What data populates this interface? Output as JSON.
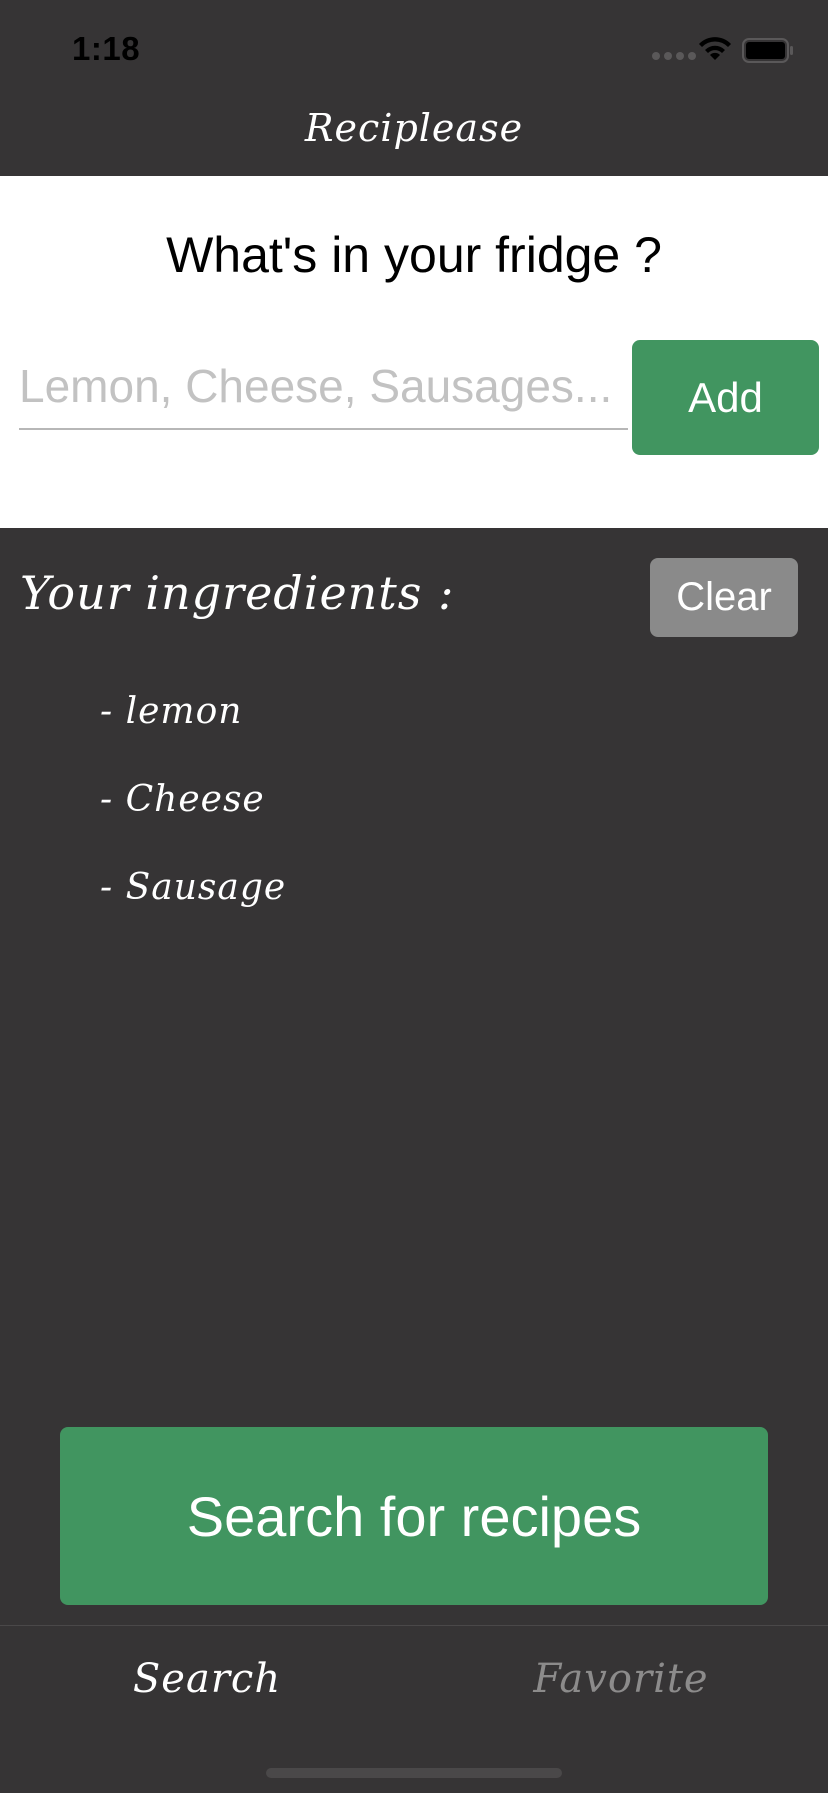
{
  "status_bar": {
    "time": "1:18",
    "icons": [
      "signal-icon",
      "wifi-icon",
      "battery-icon"
    ]
  },
  "nav": {
    "title": "Reciplease"
  },
  "fridge": {
    "question": "What's in your fridge ?",
    "input_placeholder": "Lemon, Cheese, Sausages...",
    "input_value": "",
    "add_label": "Add"
  },
  "ingredients": {
    "header": "Your ingredients :",
    "clear_label": "Clear",
    "items": [
      {
        "label": "- lemon"
      },
      {
        "label": "- Cheese"
      },
      {
        "label": "- Sausage"
      }
    ]
  },
  "search_button_label": "Search for recipes",
  "tabs": [
    {
      "label": "Search",
      "selected": true
    },
    {
      "label": "Favorite",
      "selected": false
    }
  ],
  "colors": {
    "background": "#363435",
    "accent_green": "#419560",
    "clear_gray": "#8a8a8a",
    "tab_inactive": "#8c8b8b"
  }
}
